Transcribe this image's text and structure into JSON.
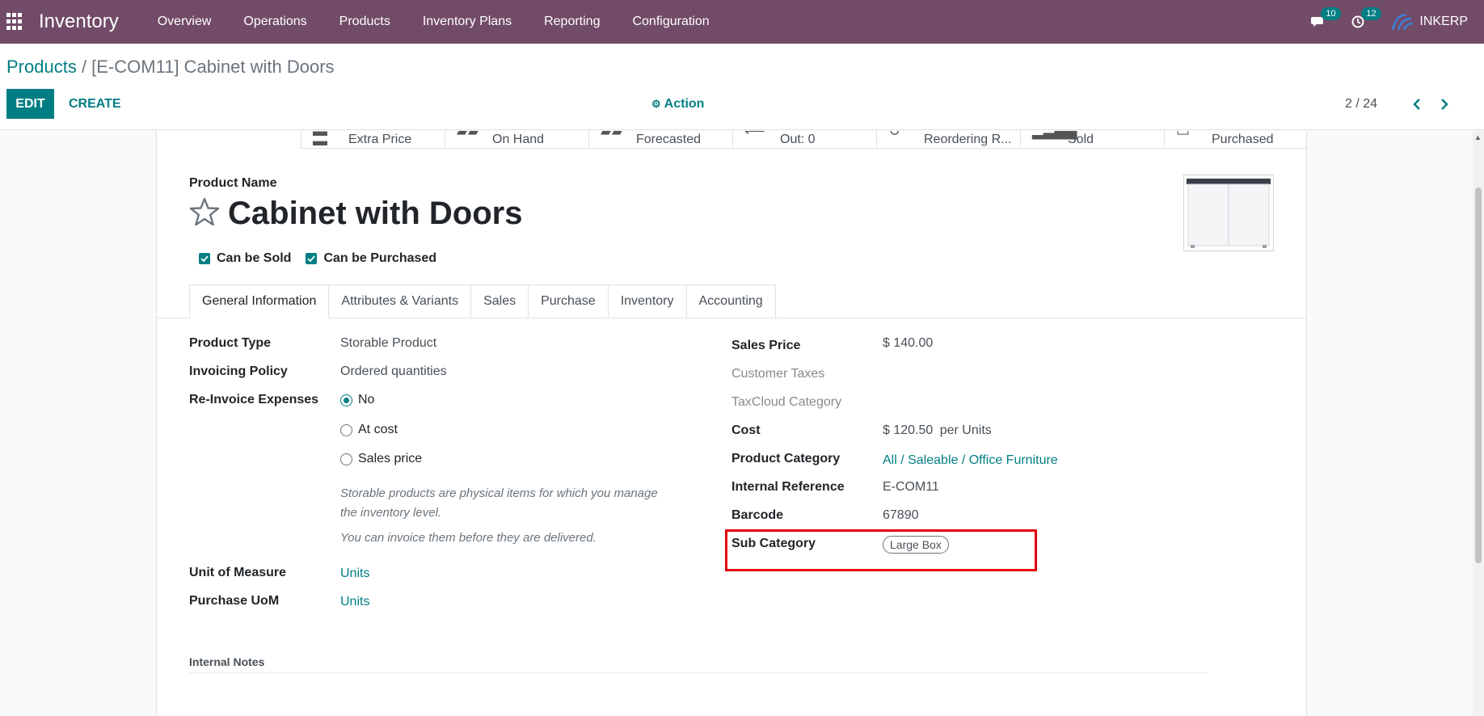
{
  "navbar": {
    "app_title": "Inventory",
    "menu": [
      "Overview",
      "Operations",
      "Products",
      "Inventory Plans",
      "Reporting",
      "Configuration"
    ],
    "messages_count": "10",
    "activities_count": "12",
    "company": "INKERP",
    "bg_color": "#714b67"
  },
  "control_panel": {
    "breadcrumb_parent": "Products",
    "breadcrumb_separator": " / ",
    "breadcrumb_current": "[E-COM11] Cabinet with Doors",
    "edit_label": "EDIT",
    "create_label": "CREATE",
    "action_label": "Action",
    "pager": "2 / 24"
  },
  "smart_buttons": [
    {
      "label": "Extra Price",
      "icon": "list-icon"
    },
    {
      "label": "On Hand",
      "icon": "cubes-icon"
    },
    {
      "label": "Forecasted",
      "icon": "cubes-icon"
    },
    {
      "label": "Out:  0",
      "icon": "arrow-left-icon"
    },
    {
      "label": "Reordering R...",
      "icon": "refresh-icon"
    },
    {
      "label": "Sold",
      "icon": "signal-icon"
    },
    {
      "label": "Purchased",
      "icon": "credit-card-icon"
    }
  ],
  "product": {
    "name_label": "Product Name",
    "name": "Cabinet with Doors",
    "can_be_sold_label": "Can be Sold",
    "can_be_purchased_label": "Can be Purchased"
  },
  "tabs": [
    "General Information",
    "Attributes & Variants",
    "Sales",
    "Purchase",
    "Inventory",
    "Accounting"
  ],
  "left_fields": {
    "product_type_label": "Product Type",
    "product_type": "Storable Product",
    "invoicing_policy_label": "Invoicing Policy",
    "invoicing_policy": "Ordered quantities",
    "reinvoice_label": "Re-Invoice Expenses",
    "reinvoice_options": [
      "No",
      "At cost",
      "Sales price"
    ],
    "reinvoice_selected": "No",
    "help_line1": "Storable products are physical items for which you manage",
    "help_line2": "the inventory level.",
    "help_line3": "You can invoice them before they are delivered.",
    "uom_label": "Unit of Measure",
    "uom": "Units",
    "purchase_uom_label": "Purchase UoM",
    "purchase_uom": "Units"
  },
  "right_fields": {
    "sales_price_label": "Sales Price",
    "sales_price": "$ 140.00",
    "customer_taxes_label": "Customer Taxes",
    "taxcloud_label": "TaxCloud Category",
    "cost_label": "Cost",
    "cost": "$ 120.50",
    "cost_unit": "per Units",
    "category_label": "Product Category",
    "category": "All / Saleable / Office Furniture",
    "internal_ref_label": "Internal Reference",
    "internal_ref": "E-COM11",
    "barcode_label": "Barcode",
    "barcode": "67890",
    "sub_category_label": "Sub Category",
    "sub_category_tag": "Large Box"
  },
  "notes": {
    "label": "Internal Notes"
  },
  "colors": {
    "accent": "#017e84",
    "highlight": "#e3000f"
  }
}
